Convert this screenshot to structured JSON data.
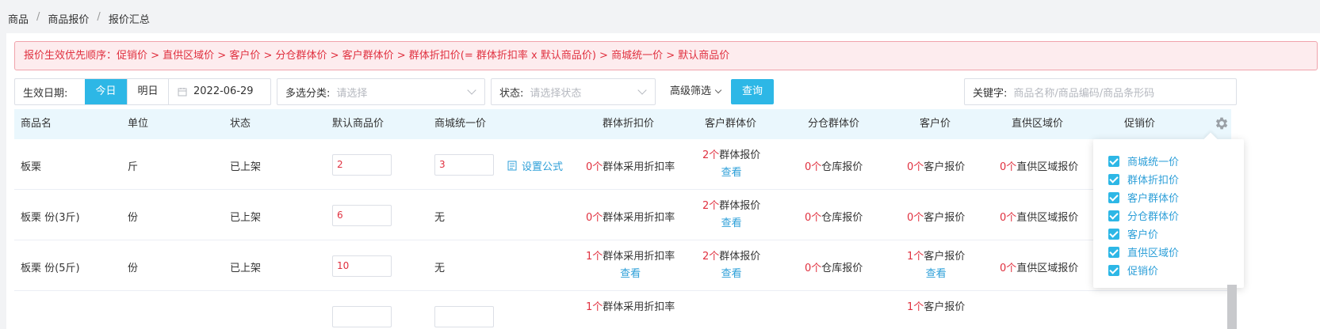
{
  "breadcrumb": [
    "商品",
    "商品报价",
    "报价汇总"
  ],
  "notice": "报价生效优先顺序：促销价 > 直供区域价 > 客户价 > 分仓群体价 > 客户群体价 > 群体折扣价(= 群体折扣率 x 默认商品价) > 商城统一价 > 默认商品价",
  "filters": {
    "date_label": "生效日期:",
    "today": "今日",
    "tomorrow": "明日",
    "date_value": "2022-06-29",
    "category_label": "多选分类:",
    "category_placeholder": "请选择",
    "status_label": "状态:",
    "status_placeholder": "请选择状态",
    "advanced": "高级筛选",
    "query": "查询",
    "keyword_label": "关键字:",
    "keyword_placeholder": "商品名称/商品编码/商品条形码"
  },
  "columns": [
    "商品名",
    "单位",
    "状态",
    "默认商品价",
    "商城统一价",
    "群体折扣价",
    "客户群体价",
    "分仓群体价",
    "客户价",
    "直供区域价",
    "促销价"
  ],
  "set_formula": "设置公式",
  "view": "查看",
  "rows": [
    {
      "name": "板栗",
      "unit": "斤",
      "status": "已上架",
      "default_price": "2",
      "mall_price": "3",
      "group_discount": {
        "count": "0个",
        "text": "群体采用折扣率"
      },
      "customer_group": {
        "count": "2个",
        "text": "群体报价"
      },
      "warehouse_group": {
        "count": "0个",
        "text": "仓库报价"
      },
      "customer": {
        "count": "0个",
        "text": "客户报价"
      },
      "direct_region": {
        "count": "0个",
        "text": "直供区域报价"
      }
    },
    {
      "name": "板栗 份(3斤)",
      "unit": "份",
      "status": "已上架",
      "default_price": "6",
      "mall_price": "无",
      "group_discount": {
        "count": "0个",
        "text": "群体采用折扣率"
      },
      "customer_group": {
        "count": "2个",
        "text": "群体报价"
      },
      "warehouse_group": {
        "count": "0个",
        "text": "仓库报价"
      },
      "customer": {
        "count": "0个",
        "text": "客户报价"
      },
      "direct_region": {
        "count": "0个",
        "text": "直供区域报价"
      }
    },
    {
      "name": "板栗 份(5斤)",
      "unit": "份",
      "status": "已上架",
      "default_price": "10",
      "mall_price": "无",
      "group_discount": {
        "count": "1个",
        "text": "群体采用折扣率"
      },
      "customer_group": {
        "count": "2个",
        "text": "群体报价"
      },
      "warehouse_group": {
        "count": "0个",
        "text": "仓库报价"
      },
      "customer": {
        "count": "1个",
        "text": "客户报价"
      },
      "direct_region": {
        "count": "0个",
        "text": "直供区域报价"
      }
    },
    {
      "group_discount": {
        "count": "1个",
        "text": "群体采用折扣率"
      },
      "customer": {
        "count": "1个",
        "text": "客户报价"
      }
    }
  ],
  "column_menu": [
    "商城统一价",
    "群体折扣价",
    "客户群体价",
    "分仓群体价",
    "客户价",
    "直供区域价",
    "促销价"
  ],
  "icons": {
    "gear": "gear-icon",
    "calendar": "calendar-icon",
    "formula": "formula-icon"
  },
  "colors": {
    "accent": "#2db7e6",
    "danger": "#e0303f",
    "link": "#2d9fd8"
  }
}
